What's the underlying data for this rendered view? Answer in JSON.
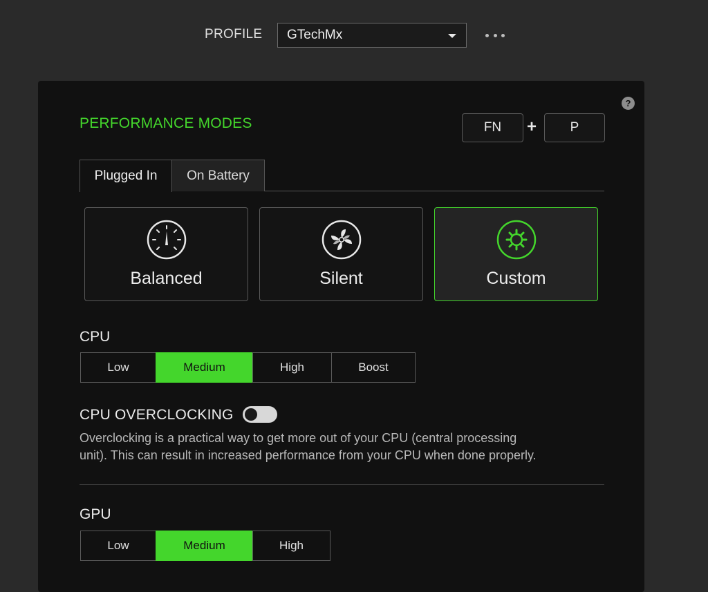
{
  "header": {
    "profile_label": "PROFILE",
    "profile_value": "GTechMx"
  },
  "performance": {
    "title": "PERFORMANCE MODES",
    "shortcut": {
      "key1": "FN",
      "plus": "+",
      "key2": "P"
    },
    "help": "?",
    "tabs": [
      {
        "label": "Plugged In",
        "active": true
      },
      {
        "label": "On Battery",
        "active": false
      }
    ],
    "modes": [
      {
        "label": "Balanced",
        "icon": "speedometer-icon",
        "active": false
      },
      {
        "label": "Silent",
        "icon": "fan-icon",
        "active": false
      },
      {
        "label": "Custom",
        "icon": "gear-icon",
        "active": true
      }
    ]
  },
  "cpu": {
    "label": "CPU",
    "options": [
      "Low",
      "Medium",
      "High",
      "Boost"
    ],
    "selected": "Medium"
  },
  "overclocking": {
    "title": "CPU OVERCLOCKING",
    "enabled": false,
    "line1": "Overclocking is a practical way to get more out of your CPU (central processing",
    "line2": "unit). This can result in increased performance from your CPU when done properly."
  },
  "gpu": {
    "label": "GPU",
    "options": [
      "Low",
      "Medium",
      "High"
    ],
    "selected": "Medium"
  },
  "colors": {
    "accent": "#44d62c",
    "panel": "#111111",
    "background": "#2a2a2a"
  }
}
